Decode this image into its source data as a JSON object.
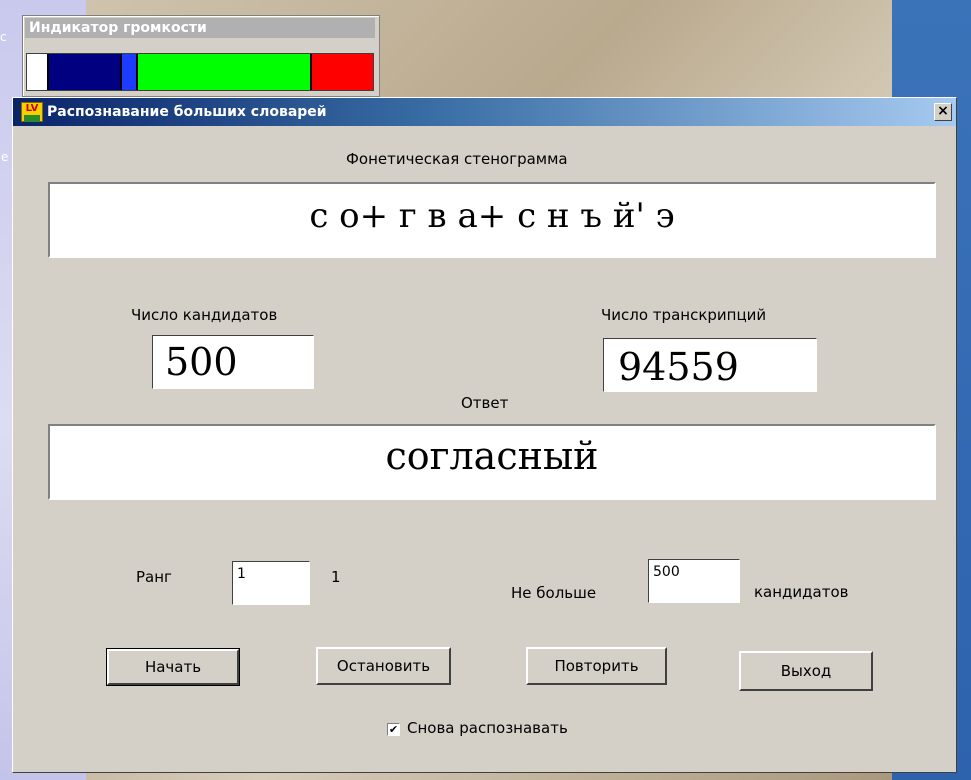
{
  "volume_indicator": {
    "title": "Индикатор громкости",
    "segments": [
      {
        "color": "#ffffff",
        "fraction": 0.065
      },
      {
        "color": "#000080",
        "fraction": 0.21
      },
      {
        "color": "#1e3cff",
        "fraction": 0.045
      },
      {
        "color": "#00ff00",
        "fraction": 0.505
      },
      {
        "color": "#ff0000",
        "fraction": 0.175
      }
    ]
  },
  "dialog": {
    "title": "Распознавание больших словарей",
    "icon_text": "LV",
    "close_symbol": "×",
    "phonetic": {
      "label": "Фонетическая стенограмма",
      "value": "с о+ г в а+ с н ъ й' э"
    },
    "candidates": {
      "label": "Число кандидатов",
      "value": "500"
    },
    "transcriptions": {
      "label": "Число транскрипций",
      "value": "94559"
    },
    "answer": {
      "label": "Ответ",
      "value": "согласный"
    },
    "rank": {
      "label": "Ранг",
      "input_value": "1",
      "display_value": "1"
    },
    "limit": {
      "label_before": "Не больше",
      "input_value": "500",
      "label_after": "кандидатов"
    },
    "buttons": {
      "start": "Начать",
      "stop": "Остановить",
      "repeat": "Повторить",
      "exit": "Выход"
    },
    "recognize_again": {
      "checked": true,
      "label": "Снова распознавать"
    }
  }
}
